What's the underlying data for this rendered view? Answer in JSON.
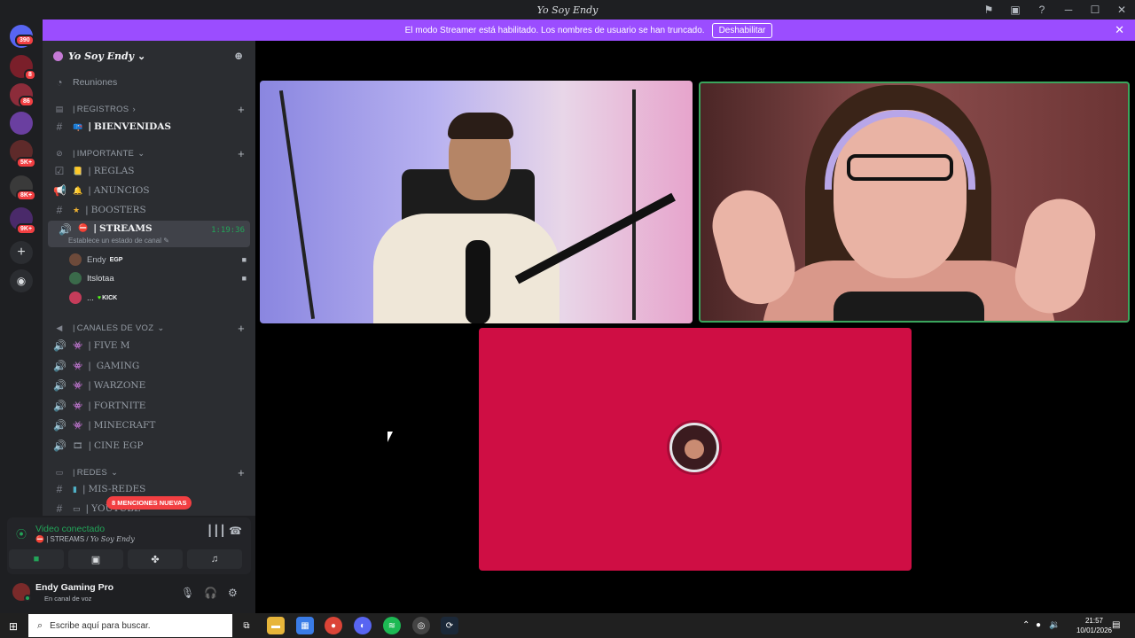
{
  "window": {
    "title": "Yo Soy Endy"
  },
  "banner": {
    "text": "El modo Streamer está habilitado. Los nombres de usuario se han truncado.",
    "button": "Deshabilitar"
  },
  "servers": {
    "badges": [
      "390",
      "8",
      "86",
      "5K+",
      "8K+",
      "9K+"
    ]
  },
  "guild": {
    "name": "Yo Soy Endy",
    "meetings": "Reuniones"
  },
  "channels": {
    "registros": "REGISTROS",
    "bienvenidas": "BIENVENIDAS",
    "importante": "IMPORTANTE",
    "reglas": "REGLAS",
    "anuncios": "ANUNCIOS",
    "boosters": "BOOSTERS",
    "streams": "STREAMS",
    "streams_time": "1:19:36",
    "streams_status": "Establece un estado de canal",
    "canales_de_voz": "CANALES DE VOZ",
    "five_m": "FIVE M",
    "gaming": "GAMING",
    "warzone": "WARZONE",
    "fortnite": "FORTNITE",
    "minecraft": "MINECRAFT",
    "cine_egp": "CINE EGP",
    "redes": "REDES",
    "mis_redes": "MIS-REDES",
    "youtube": "YOUTUBE"
  },
  "voice_users": [
    {
      "name": "Endy",
      "tag": "EGP"
    },
    {
      "name": "Itslotaa",
      "tag": ""
    },
    {
      "name": "...",
      "tag": "KICK"
    }
  ],
  "mentions": "8 MENCIONES NUEVAS",
  "voice_panel": {
    "status": "Video conectado",
    "channel": "STREAMS",
    "server": "Yo Soy Endy"
  },
  "user_panel": {
    "name": "Endy Gaming Pro",
    "status": "En canal de voz"
  },
  "taskbar": {
    "search_placeholder": "Escribe aquí para buscar.",
    "time": "21:57",
    "date": "10/01/2026"
  },
  "colors": {
    "banner": "#9b4dff",
    "stage_tile": "#cf0e44",
    "connected": "#23a559",
    "badge": "#f23f42"
  }
}
